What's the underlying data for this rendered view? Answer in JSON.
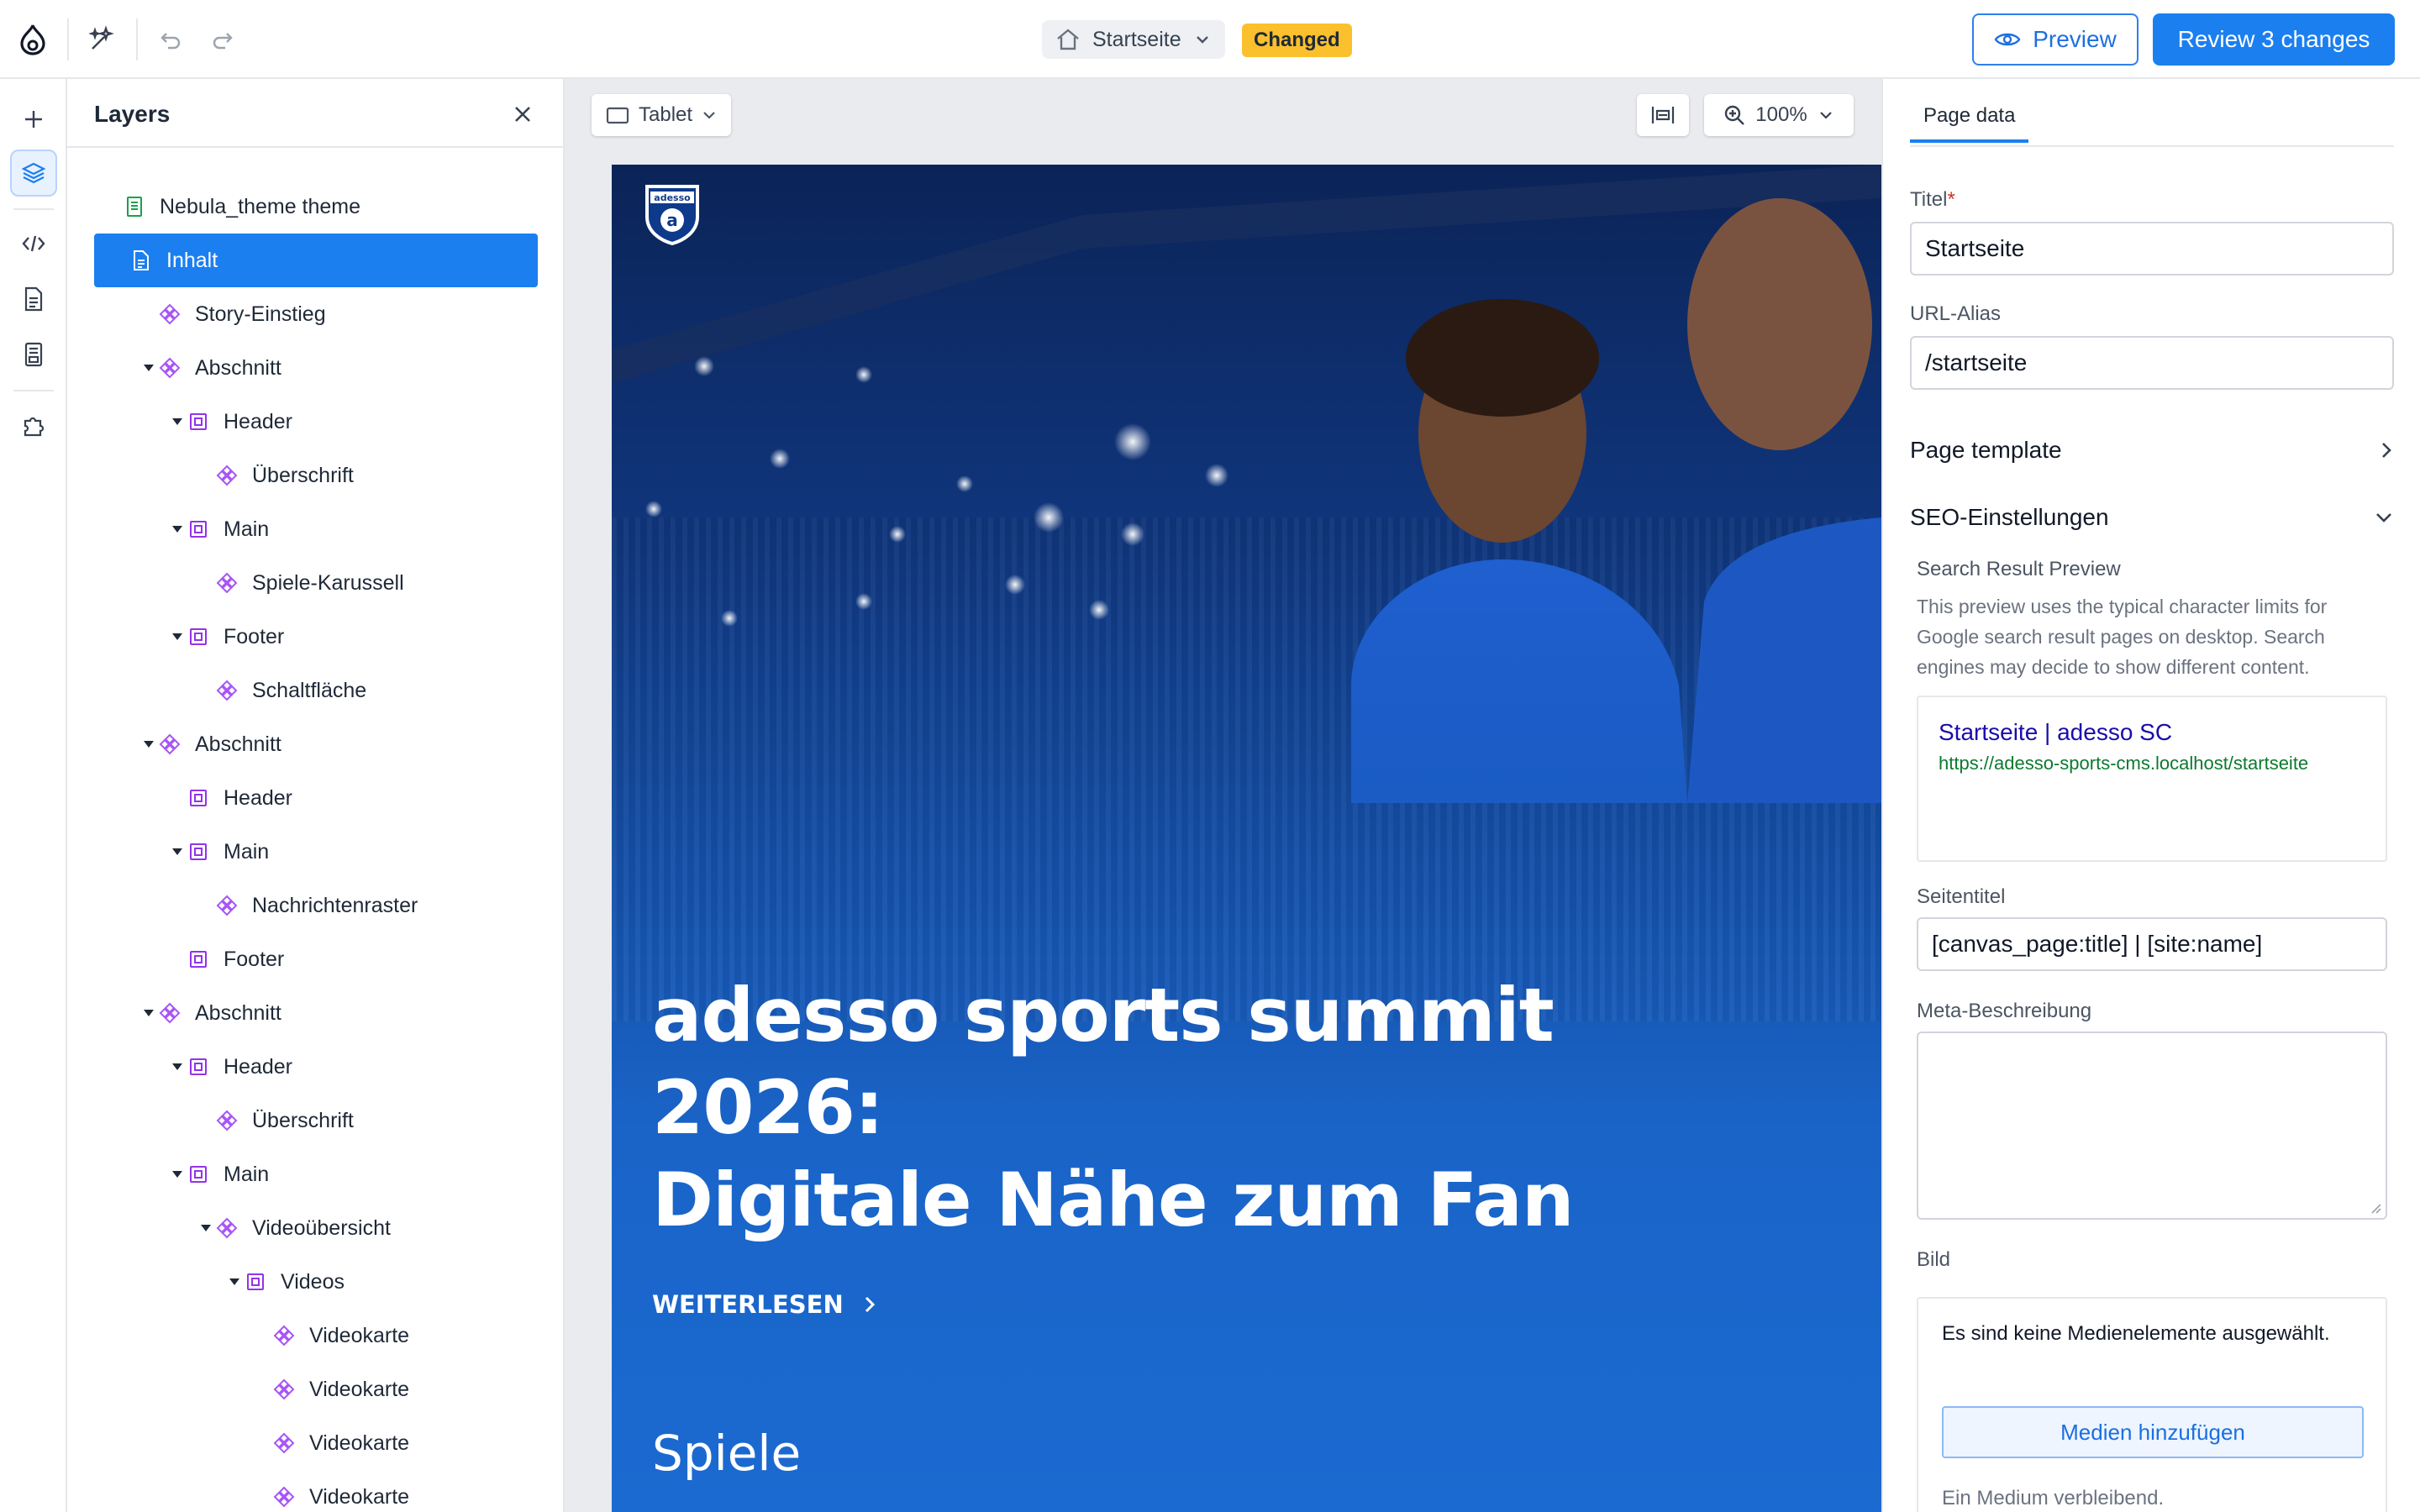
{
  "toolbar": {
    "page_switcher_label": "Startseite",
    "changed_badge": "Changed",
    "preview_label": "Preview",
    "review_label": "Review 3 changes"
  },
  "layers": {
    "title": "Layers",
    "items": [
      {
        "label": "Nebula_theme theme",
        "depth": 0,
        "icon": "page-icon-green",
        "caret": false,
        "selected": false
      },
      {
        "label": "Inhalt",
        "depth": 0,
        "icon": "document-icon",
        "caret": false,
        "selected": true
      },
      {
        "label": "Story-Einstieg",
        "depth": 1,
        "icon": "component-icon",
        "caret": false,
        "selected": false
      },
      {
        "label": "Abschnitt",
        "depth": 1,
        "icon": "component-icon",
        "caret": true,
        "selected": false
      },
      {
        "label": "Header",
        "depth": 2,
        "icon": "slot-icon",
        "caret": true,
        "selected": false
      },
      {
        "label": "Überschrift",
        "depth": 3,
        "icon": "component-icon",
        "caret": false,
        "selected": false
      },
      {
        "label": "Main",
        "depth": 2,
        "icon": "slot-icon",
        "caret": true,
        "selected": false
      },
      {
        "label": "Spiele-Karussell",
        "depth": 3,
        "icon": "component-icon",
        "caret": false,
        "selected": false
      },
      {
        "label": "Footer",
        "depth": 2,
        "icon": "slot-icon",
        "caret": true,
        "selected": false
      },
      {
        "label": "Schaltfläche",
        "depth": 3,
        "icon": "component-icon",
        "caret": false,
        "selected": false
      },
      {
        "label": "Abschnitt",
        "depth": 1,
        "icon": "component-icon",
        "caret": true,
        "selected": false
      },
      {
        "label": "Header",
        "depth": 2,
        "icon": "slot-icon",
        "caret": false,
        "selected": false
      },
      {
        "label": "Main",
        "depth": 2,
        "icon": "slot-icon",
        "caret": true,
        "selected": false
      },
      {
        "label": "Nachrichtenraster",
        "depth": 3,
        "icon": "component-icon",
        "caret": false,
        "selected": false
      },
      {
        "label": "Footer",
        "depth": 2,
        "icon": "slot-icon",
        "caret": false,
        "selected": false
      },
      {
        "label": "Abschnitt",
        "depth": 1,
        "icon": "component-icon",
        "caret": true,
        "selected": false
      },
      {
        "label": "Header",
        "depth": 2,
        "icon": "slot-icon",
        "caret": true,
        "selected": false
      },
      {
        "label": "Überschrift",
        "depth": 3,
        "icon": "component-icon",
        "caret": false,
        "selected": false
      },
      {
        "label": "Main",
        "depth": 2,
        "icon": "slot-icon",
        "caret": true,
        "selected": false
      },
      {
        "label": "Videoübersicht",
        "depth": 3,
        "icon": "component-icon",
        "caret": true,
        "selected": false
      },
      {
        "label": "Videos",
        "depth": 4,
        "icon": "slot-icon",
        "caret": true,
        "selected": false
      },
      {
        "label": "Videokarte",
        "depth": 5,
        "icon": "component-icon",
        "caret": false,
        "selected": false
      },
      {
        "label": "Videokarte",
        "depth": 5,
        "icon": "component-icon",
        "caret": false,
        "selected": false
      },
      {
        "label": "Videokarte",
        "depth": 5,
        "icon": "component-icon",
        "caret": false,
        "selected": false
      },
      {
        "label": "Videokarte",
        "depth": 5,
        "icon": "component-icon",
        "caret": false,
        "selected": false
      }
    ]
  },
  "canvas": {
    "device_label": "Tablet",
    "zoom_label": "100%",
    "preview": {
      "logo_text": "adesso",
      "hero_title_line1": "adesso sports summit 2026:",
      "hero_title_line2": "Digitale Nähe zum Fan",
      "hero_link": "WEITERLESEN",
      "section_title": "Spiele"
    }
  },
  "page_data": {
    "tab_label": "Page data",
    "title_label": "Titel",
    "title_required_mark": "*",
    "title_value": "Startseite",
    "url_alias_label": "URL-Alias",
    "url_alias_value": "/startseite",
    "page_template_label": "Page template",
    "seo_label": "SEO-Einstellungen",
    "search_preview_label": "Search Result Preview",
    "search_preview_desc": "This preview uses the typical character limits for Google search result pages on desktop. Search engines may decide to show different content.",
    "serp_title": "Startseite | adesso SC",
    "serp_url": "https://adesso-sports-cms.localhost/startseite",
    "seitentitel_label": "Seitentitel",
    "seitentitel_value": "[canvas_page:title] | [site:name]",
    "meta_label": "Meta-Beschreibung",
    "bild_label": "Bild",
    "media_empty": "Es sind keine Medienelemente ausgewählt.",
    "media_button": "Medien hinzufügen",
    "media_note": "Ein Medium verbleibend."
  },
  "colors": {
    "accent": "#1b7ff0",
    "changed_badge": "#fbc02d",
    "component_icon": "#a855f7",
    "slot_icon": "#9333ea",
    "page_icon": "#16a34a",
    "hero_blue": "#1b6ad1"
  }
}
